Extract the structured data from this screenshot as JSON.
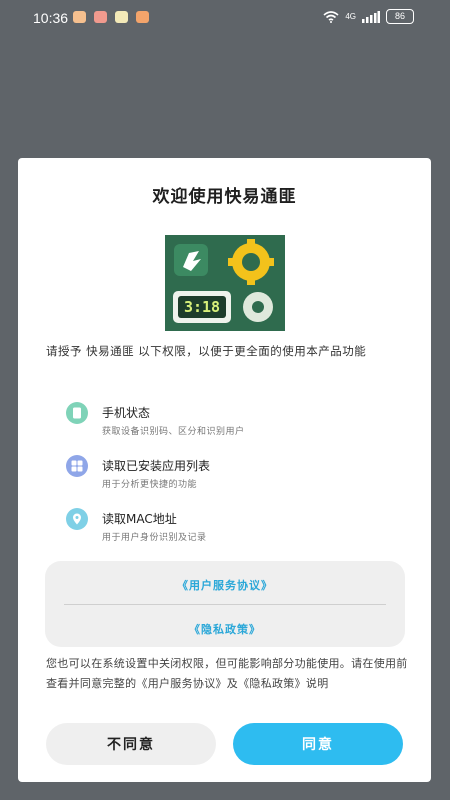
{
  "status_bar": {
    "time": "10:36",
    "network": "4G",
    "battery": "86"
  },
  "dialog": {
    "title": "欢迎使用快易通匪",
    "logo_clock": "3:18",
    "intro": "请授予 快易通匪 以下权限，以便于更全面的使用本产品功能",
    "permissions": [
      {
        "title": "手机状态",
        "desc": "获取设备识别码、区分和识别用户",
        "icon": "phone-icon",
        "color": "#7fd3b8"
      },
      {
        "title": "读取已安装应用列表",
        "desc": "用于分析更快捷的功能",
        "icon": "apps-grid-icon",
        "color": "#8fa6e8"
      },
      {
        "title": "读取MAC地址",
        "desc": "用于用户身份识别及记录",
        "icon": "location-icon",
        "color": "#7fd0e6"
      }
    ],
    "links": {
      "user_agreement": "《用户服务协议》",
      "privacy_policy": "《隐私政策》"
    },
    "note": "您也可以在系统设置中关闭权限，但可能影响部分功能使用。请在使用前查看并同意完整的《用户服务协议》及《隐私政策》说明",
    "buttons": {
      "disagree": "不同意",
      "agree": "同意"
    }
  },
  "colors": {
    "accent": "#2ebcf0",
    "link": "#2aa7d8",
    "backdrop": "#5f6469"
  }
}
